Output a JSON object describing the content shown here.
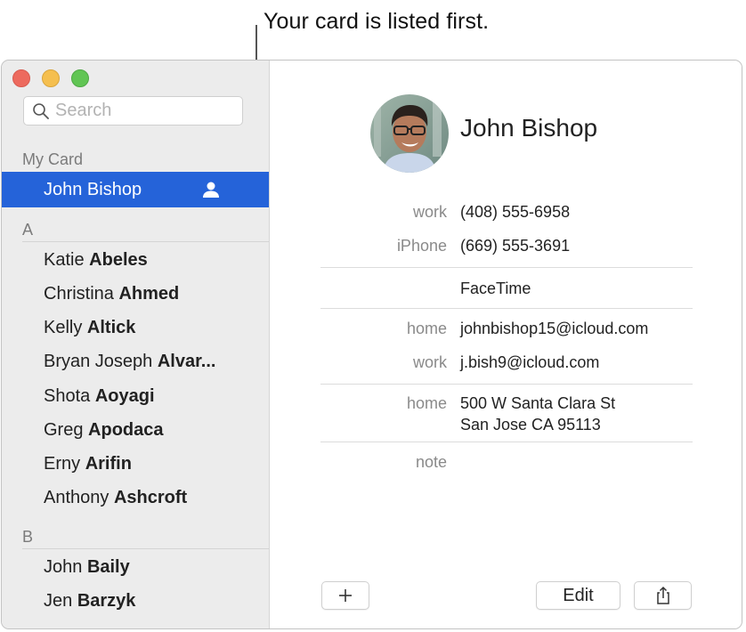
{
  "callout": {
    "text": "Your card is listed first."
  },
  "window": {
    "traffic_lights": [
      "close",
      "minimize",
      "zoom"
    ]
  },
  "sidebar": {
    "search": {
      "placeholder": "Search",
      "value": ""
    },
    "my_card": {
      "header": "My Card",
      "name": "John Bishop",
      "icon": "person-icon"
    },
    "groups": [
      {
        "letter": "A",
        "contacts": [
          {
            "first": "Katie",
            "last": "Abeles"
          },
          {
            "first": "Christina",
            "last": "Ahmed"
          },
          {
            "first": "Kelly",
            "last": "Altick"
          },
          {
            "first": "Bryan Joseph",
            "last": "Alvar..."
          },
          {
            "first": "Shota",
            "last": "Aoyagi"
          },
          {
            "first": "Greg",
            "last": "Apodaca"
          },
          {
            "first": "Erny",
            "last": "Arifin"
          },
          {
            "first": "Anthony",
            "last": "Ashcroft"
          }
        ]
      },
      {
        "letter": "B",
        "contacts": [
          {
            "first": "John",
            "last": "Baily"
          },
          {
            "first": "Jen",
            "last": "Barzyk"
          }
        ]
      }
    ]
  },
  "card": {
    "name": "John Bishop",
    "phones": [
      {
        "label": "work",
        "value": "(408) 555-6958"
      },
      {
        "label": "iPhone",
        "value": "(669) 555-3691"
      }
    ],
    "facetime": "FaceTime",
    "emails": [
      {
        "label": "home",
        "value": "johnbishop15@icloud.com"
      },
      {
        "label": "work",
        "value": "j.bish9@icloud.com"
      }
    ],
    "address": {
      "label": "home",
      "line1": "500 W Santa Clara St",
      "line2": "San Jose CA 95113"
    },
    "note": {
      "label": "note",
      "value": ""
    }
  },
  "toolbar": {
    "add_label": "+",
    "edit_label": "Edit",
    "share_icon": "share-icon"
  },
  "colors": {
    "selection": "#2563d9",
    "sidebar_bg": "#ececec",
    "label_gray": "#8a8a8a"
  }
}
